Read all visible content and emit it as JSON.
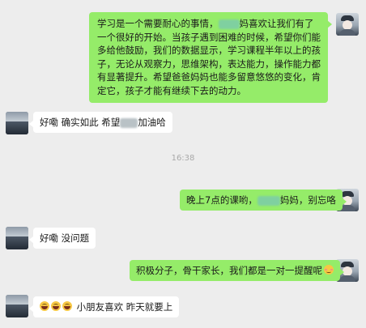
{
  "messages": [
    {
      "side": "right",
      "parts": [
        "学习是一个需要耐心的事情，",
        "[blurred]",
        "妈喜欢让我们有了一个很好的开始。当孩子遇到困难的时候，希望你们能多给他鼓励，我们的数据显示，学习课程半年以上的孩子，无论从观察力，思维架构，表达能力，操作能力都有显著提升。希望爸爸妈妈也能多留意悠悠的变化，肯定它，孩子才能有继续下去的动力。"
      ]
    },
    {
      "side": "left",
      "parts": [
        "好嘞 确实如此 希望",
        "[blurred]",
        "加油哈"
      ]
    },
    {
      "side": "right",
      "parts": [
        "晚上7点的课哟，",
        "[blurred]",
        "妈妈，别忘咯"
      ]
    },
    {
      "side": "left",
      "parts": [
        "好嘞 没问题"
      ]
    },
    {
      "side": "right",
      "parts": [
        "积极分子，骨干家长，我们都是一对一提醒呢",
        "[emoji:blush]"
      ]
    },
    {
      "side": "left",
      "parts": [
        "[emoji:smile]",
        "[emoji:smile]",
        "[emoji:smile]",
        " 小朋友喜欢 昨天就要上"
      ]
    }
  ],
  "timestamp": "16:38",
  "text": {
    "m1_a": "学习是一个需要耐心的事情，",
    "m1_b": "妈喜欢让我们有了一个很好的开始。当孩子遇到困难的时候，希望你们能多给他鼓励，我们的数据显示，学习课程半年以上的孩子，无论从观察力，思维架构，表达能力，操作能力都有显著提升。希望爸爸妈妈也能多留意悠悠的变化，肯定它，孩子才能有继续下去的动力。",
    "m2_a": "好嘞 确实如此 希望",
    "m2_b": "加油哈",
    "m3_a": "晚上7点的课哟，",
    "m3_b": "妈妈，别忘咯",
    "m4": "好嘞 没问题",
    "m5": "积极分子，骨干家长，我们都是一对一提醒呢",
    "m6": "小朋友喜欢 昨天就要上"
  },
  "colors": {
    "background": "#ededed",
    "sent_bubble": "#95ec69",
    "received_bubble": "#ffffff",
    "timestamp": "#a9a9a9"
  },
  "icons": {
    "self_avatar": "avatar-cartoon-person",
    "contact_avatar": "avatar-landscape",
    "emoji_blush": "blush-emoji-icon",
    "emoji_smile": "grin-emoji-icon"
  }
}
